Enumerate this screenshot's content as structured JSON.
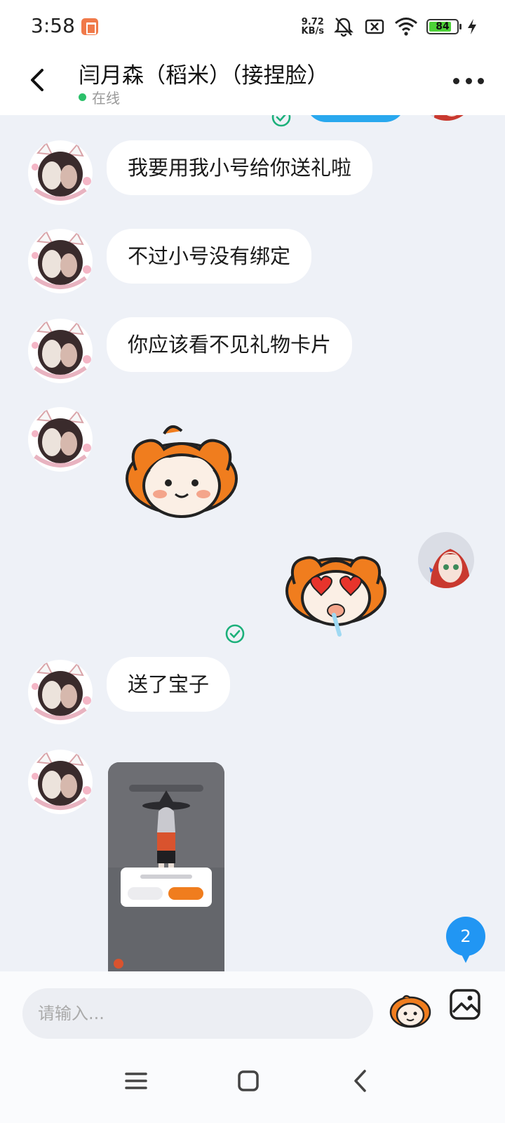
{
  "status_bar": {
    "time": "3:58",
    "net_speed_value": "9.72",
    "net_speed_unit": "KB/s",
    "battery": "84",
    "icons": [
      "app-notification-icon",
      "mute-icon",
      "no-sim-icon",
      "wifi-icon",
      "battery-icon",
      "charging-icon"
    ]
  },
  "header": {
    "title": "闫月森（稻米）（接捏脸）",
    "status": "在线",
    "status_color": "#2bc06a"
  },
  "messages": [
    {
      "side": "left",
      "type": "text",
      "text": "我要用我小号给你送礼啦"
    },
    {
      "side": "left",
      "type": "text",
      "text": "不过小号没有绑定"
    },
    {
      "side": "left",
      "type": "text",
      "text": "你应该看不见礼物卡片"
    },
    {
      "side": "left",
      "type": "sticker",
      "sticker": "smiling-mascot-sticker"
    },
    {
      "side": "right",
      "type": "sticker",
      "sticker": "heart-eyes-mascot-sticker",
      "status": "read"
    },
    {
      "side": "left",
      "type": "text",
      "text": "送了宝子"
    },
    {
      "side": "left",
      "type": "image",
      "image": "gift-screenshot-thumbnail"
    }
  ],
  "unread_count": "2",
  "input": {
    "placeholder": "请输入..."
  },
  "colors": {
    "accent": "#2196f3",
    "chat_background": "#eef1f7",
    "bubble": "#ffffff",
    "check": "#1bb07a"
  }
}
